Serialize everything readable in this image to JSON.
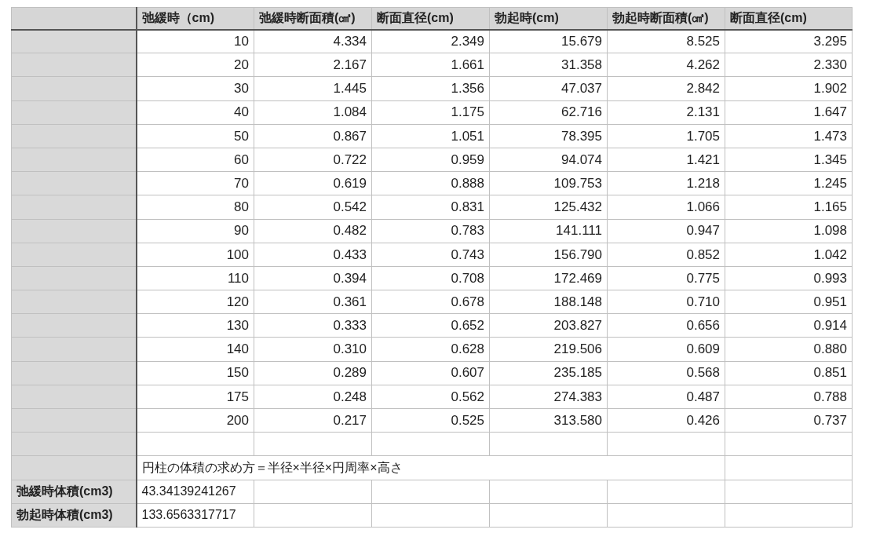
{
  "columns": [
    "弛緩時（cm)",
    "弛緩時断面積(㎠)",
    "断面直径(cm)",
    "勃起時(cm)",
    "勃起時断面積(㎠)",
    "断面直径(cm)"
  ],
  "rows": [
    [
      "10",
      "4.334",
      "2.349",
      "15.679",
      "8.525",
      "3.295"
    ],
    [
      "20",
      "2.167",
      "1.661",
      "31.358",
      "4.262",
      "2.330"
    ],
    [
      "30",
      "1.445",
      "1.356",
      "47.037",
      "2.842",
      "1.902"
    ],
    [
      "40",
      "1.084",
      "1.175",
      "62.716",
      "2.131",
      "1.647"
    ],
    [
      "50",
      "0.867",
      "1.051",
      "78.395",
      "1.705",
      "1.473"
    ],
    [
      "60",
      "0.722",
      "0.959",
      "94.074",
      "1.421",
      "1.345"
    ],
    [
      "70",
      "0.619",
      "0.888",
      "109.753",
      "1.218",
      "1.245"
    ],
    [
      "80",
      "0.542",
      "0.831",
      "125.432",
      "1.066",
      "1.165"
    ],
    [
      "90",
      "0.482",
      "0.783",
      "141.111",
      "0.947",
      "1.098"
    ],
    [
      "100",
      "0.433",
      "0.743",
      "156.790",
      "0.852",
      "1.042"
    ],
    [
      "110",
      "0.394",
      "0.708",
      "172.469",
      "0.775",
      "0.993"
    ],
    [
      "120",
      "0.361",
      "0.678",
      "188.148",
      "0.710",
      "0.951"
    ],
    [
      "130",
      "0.333",
      "0.652",
      "203.827",
      "0.656",
      "0.914"
    ],
    [
      "140",
      "0.310",
      "0.628",
      "219.506",
      "0.609",
      "0.880"
    ],
    [
      "150",
      "0.289",
      "0.607",
      "235.185",
      "0.568",
      "0.851"
    ],
    [
      "175",
      "0.248",
      "0.562",
      "274.383",
      "0.487",
      "0.788"
    ],
    [
      "200",
      "0.217",
      "0.525",
      "313.580",
      "0.426",
      "0.737"
    ]
  ],
  "formula": "円柱の体積の求め方＝半径×半径×円周率×高さ",
  "volumes": [
    {
      "label": "弛緩時体積(cm3)",
      "value": "43.34139241267"
    },
    {
      "label": "勃起時体積(cm3)",
      "value": "133.6563317717"
    }
  ]
}
